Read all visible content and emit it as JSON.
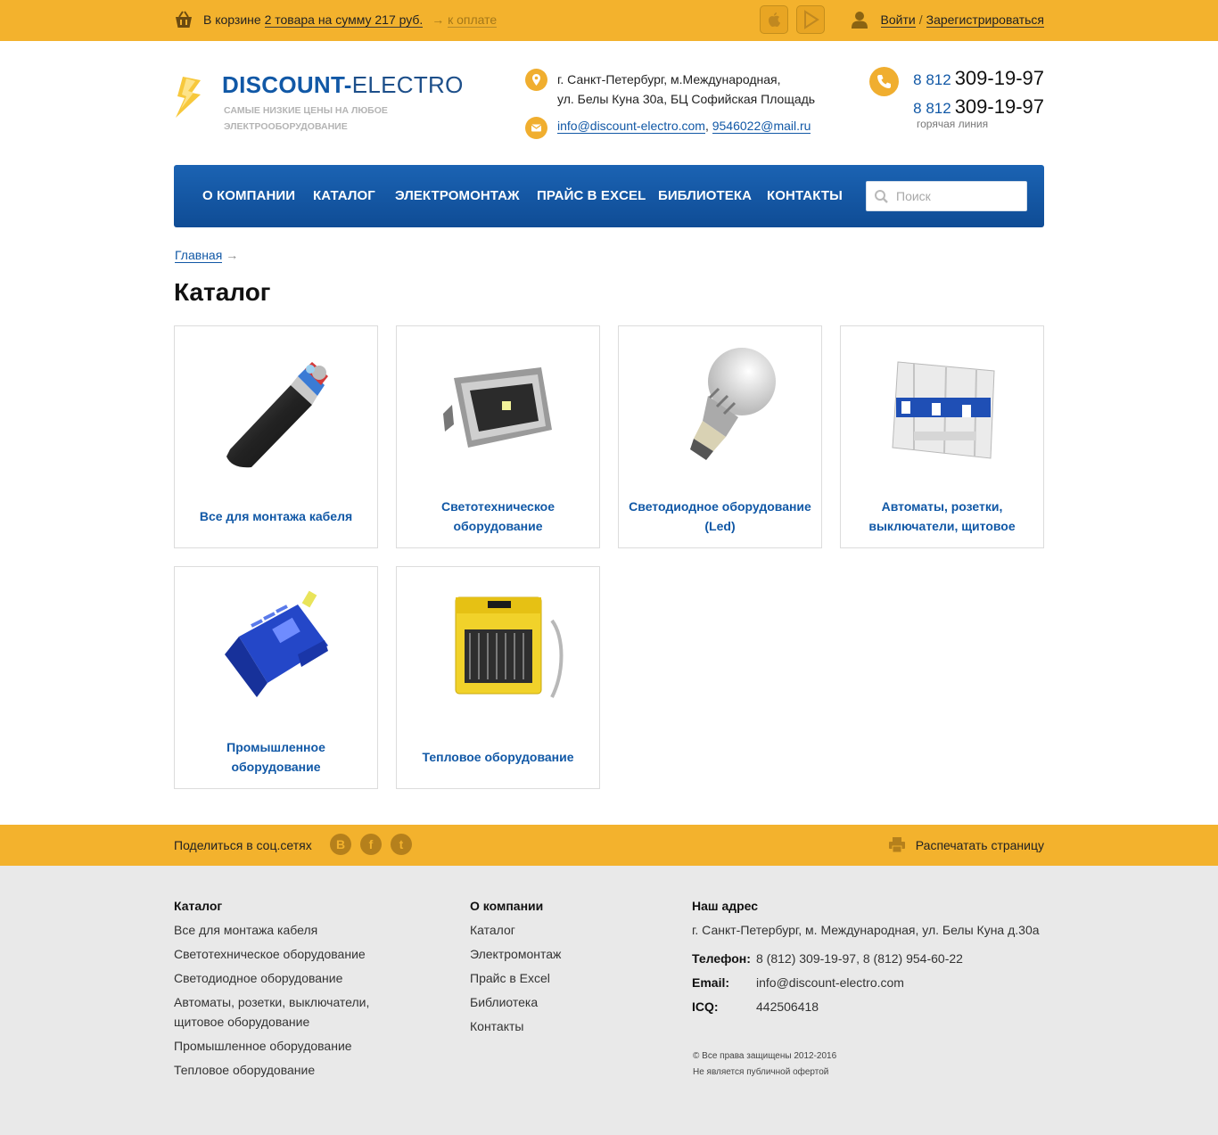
{
  "topbar": {
    "cart_prefix": "В корзине",
    "cart_summary": "2 товара на сумму 217 руб.",
    "pay_arrow": "→",
    "pay_label": "к оплате",
    "login": "Войти",
    "separator": "/",
    "register": "Зарегистрироваться"
  },
  "header": {
    "logo_bold": "DISCOUNT-",
    "logo_light": "ELECTRO",
    "tagline": "Самые низкие цены на любое электрооборудование",
    "address_line1": "г. Санкт-Петербург, м.Международная,",
    "address_line2": "ул. Белы Куна 30а, БЦ Софийская Площадь",
    "email1": "info@discount-electro.com",
    "email_separator": ",",
    "email2": "9546022@mail.ru",
    "phones": [
      {
        "code": "8 812",
        "number": "309-19-97"
      },
      {
        "code": "8 812",
        "number": "309-19-97"
      }
    ],
    "hotline": "горячая линия"
  },
  "nav": {
    "items": [
      "О компании",
      "Каталог",
      "Электромонтаж",
      "Прайс в Excel",
      "Библиотека",
      "Контакты"
    ],
    "search_placeholder": "Поиск"
  },
  "breadcrumb": {
    "home": "Главная",
    "arrow": "→"
  },
  "page_title": "Каталог",
  "catalog": [
    {
      "label": "Все для монтажа кабеля",
      "image": "cable"
    },
    {
      "label": "Светотехническое оборудование",
      "image": "floodlight"
    },
    {
      "label": "Светодиодное оборудование (Led)",
      "image": "led-bulb"
    },
    {
      "label": "Автоматы, розетки, выключатели, щитовое",
      "image": "circuit-breaker"
    },
    {
      "label": "Промышленное оборудование",
      "image": "electric-motor"
    },
    {
      "label": "Тепловое оборудование",
      "image": "heater"
    }
  ],
  "sharebar": {
    "share_label": "Поделиться в соц.сетях",
    "social": [
      {
        "glyph": "B",
        "icon": "vk-icon"
      },
      {
        "glyph": "f",
        "icon": "facebook-icon"
      },
      {
        "glyph": "t",
        "icon": "twitter-icon"
      }
    ],
    "print_label": "Распечатать страницу"
  },
  "footer": {
    "catalog_title": "Каталог",
    "catalog_items": [
      "Все для монтажа кабеля",
      "Светотехническое оборудование",
      "Светодиодное оборудование",
      "Автоматы, розетки, выключатели, щитовое оборудование",
      "Промышленное оборудование",
      "Тепловое оборудование"
    ],
    "company_title": "О компании",
    "company_items": [
      "Каталог",
      "Электромонтаж",
      "Прайс в Excel",
      "Библиотека",
      "Контакты"
    ],
    "address_title": "Наш адрес",
    "address": "г. Санкт-Петербург, м. Международная, ул. Белы Куна д.30а",
    "phone_key": "Телефон:",
    "phone_value": "8 (812) 309-19-97, 8 (812) 954-60-22",
    "email_key": "Email:",
    "email_value": "info@discount-electro.com",
    "icq_key": "ICQ:",
    "icq_value": "442506418",
    "copyright": "© Все права защищены 2012-2016",
    "offer_note": "Не является публичной офертой"
  },
  "colors": {
    "accent": "#f3b22d",
    "brand_blue": "#1158a6",
    "footer_bg": "#e9e9e9"
  }
}
